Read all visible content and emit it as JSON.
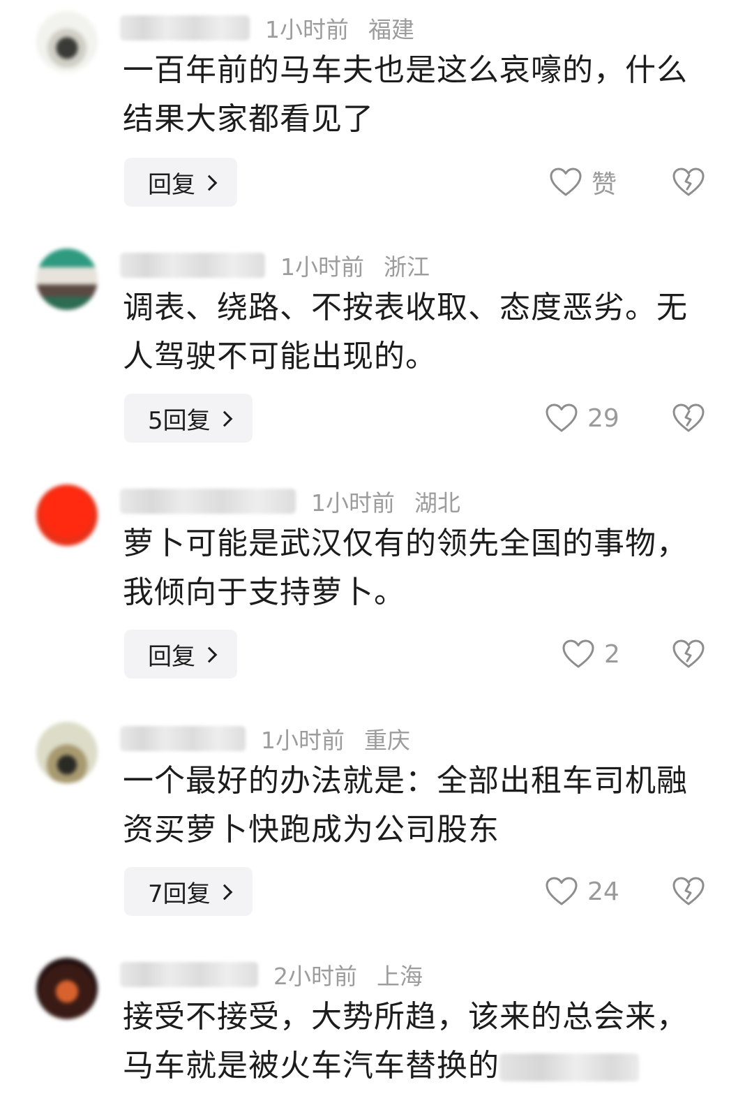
{
  "comments": [
    {
      "time": "1小时前",
      "location": "福建",
      "content": "一百年前的马车夫也是这么哀嚎的，什么结果大家都看见了",
      "reply_label": "回复",
      "like_label": "赞",
      "avatar_colors": [
        "#f2f2ee",
        "#3a3a36",
        "#cfcfc6"
      ]
    },
    {
      "time": "1小时前",
      "location": "浙江",
      "content": "调表、绕路、不按表收取、态度恶劣。无人驾驶不可能出现的。",
      "reply_label": "5回复",
      "like_label": "29",
      "avatar_colors": [
        "#2f9a80",
        "#e7e2dc",
        "#5b4a44"
      ]
    },
    {
      "time": "1小时前",
      "location": "湖北",
      "content": "萝卜可能是武汉仅有的领先全国的事物，我倾向于支持萝卜。",
      "reply_label": "回复",
      "like_label": "2",
      "avatar_colors": [
        "#ff2a10",
        "#f0311c",
        "#e83118"
      ]
    },
    {
      "time": "1小时前",
      "location": "重庆",
      "content": "一个最好的办法就是：全部出租车司机融资买萝卜快跑成为公司股东",
      "reply_label": "7回复",
      "like_label": "24",
      "avatar_colors": [
        "#dcdcc8",
        "#a89a70",
        "#2a2a24"
      ]
    },
    {
      "time": "2小时前",
      "location": "上海",
      "content": "接受不接受，大势所趋，该来的总会来，马车就是被火车汽车替换的",
      "reply_label": "",
      "like_label": "",
      "avatar_colors": [
        "#3a1a14",
        "#d8622e",
        "#201010"
      ]
    }
  ]
}
